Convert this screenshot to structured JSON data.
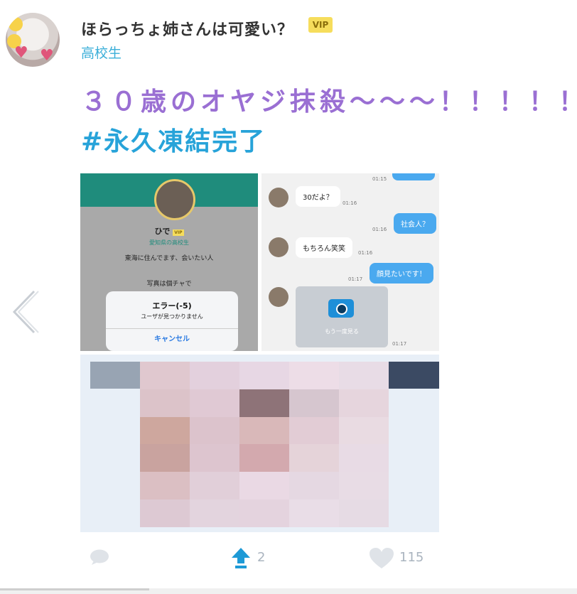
{
  "post": {
    "username": "ほらっちょ姉さんは可愛い？",
    "badge": "VIP",
    "school": "高校生",
    "title_line1": "３０歳のオヤジ抹殺〜〜〜！！！！！",
    "title_line2": "#永久凍結完了"
  },
  "screenshot_profile": {
    "name": "ひで",
    "badge": "VIP",
    "prefecture": "愛知県の高校生",
    "bio": "東海に住んでます、会いたい人",
    "bio2": "写真は個チャで",
    "dialog_title": "エラー(-5)",
    "dialog_message": "ユーザが見つかりません",
    "dialog_button": "キャンセル"
  },
  "screenshot_chat": {
    "messages": [
      {
        "side": "left",
        "text": "30だよ？",
        "time": "01:16"
      },
      {
        "side": "right",
        "text": "社会人？",
        "time": "01:16"
      },
      {
        "side": "left",
        "text": "もちろん笑笑",
        "time": "01:16"
      },
      {
        "side": "right",
        "text": "顔見たいです！",
        "time": "01:17"
      }
    ],
    "top_time": "01:15",
    "photo_caption": "もう一度見る",
    "photo_time": "01:17"
  },
  "actions": {
    "upvotes": "2",
    "likes": "115"
  },
  "mosaic_colors": [
    "#e0c8cf",
    "#e3d0dd",
    "#e7d7e4",
    "#eddde7",
    "#e8dce6",
    "#dcc3c9",
    "#e0c9d4",
    "#8e7378",
    "#d6c6cf",
    "#e6d5dd",
    "#cea79e",
    "#dcc3cc",
    "#d9b8b9",
    "#e2ccd5",
    "#e9dbe2",
    "#c9a39f",
    "#ddc5cf",
    "#d3a9ae",
    "#e5d3d9",
    "#e8dbe5",
    "#dbbfc3",
    "#e1cfd9",
    "#ead9e4",
    "#e5d8e2",
    "#e8dce5",
    "#ddc9d3",
    "#e3d4de",
    "#e4d3de",
    "#e9dde7",
    "#e6dbe4"
  ],
  "colors": {
    "title1": "#9a6fd3",
    "title2": "#27a3d9",
    "school": "#3aaed8",
    "vip": "#f6dd5c"
  }
}
